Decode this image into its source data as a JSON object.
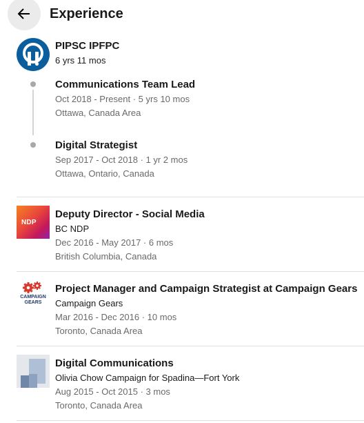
{
  "header": {
    "title": "Experience"
  },
  "experience": [
    {
      "company": "PIPSC IPFPC",
      "duration": "6 yrs 11 mos",
      "roles": [
        {
          "title": "Communications Team Lead",
          "dates": "Oct 2018 - Present · 5 yrs 10 mos",
          "location": "Ottawa, Canada Area"
        },
        {
          "title": "Digital Strategist",
          "dates": "Sep 2017 - Oct 2018 · 1 yr 2 mos",
          "location": "Ottawa, Ontario, Canada"
        }
      ]
    },
    {
      "title": "Deputy Director - Social Media",
      "company": "BC NDP",
      "dates": "Dec 2016 - May 2017 · 6 mos",
      "location": "British Columbia, Canada",
      "logo_text": "NDP"
    },
    {
      "title": "Project Manager and Campaign Strategist at Campaign Gears",
      "company": "Campaign Gears",
      "dates": "Mar 2016 - Dec 2016 · 10 mos",
      "location": "Toronto, Canada Area",
      "logo_line1": "CAMPAIGN",
      "logo_line2": "GEARS"
    },
    {
      "title": "Digital Communications",
      "company": "Olivia Chow Campaign for Spadina—Fort York",
      "dates": "Aug 2015 - Oct 2015 · 3 mos",
      "location": "Toronto, Canada Area"
    }
  ],
  "colors": {
    "pipsc_blue": "#0a5e9e",
    "ndp_orange": "#f58220",
    "gears_red": "#d9392b",
    "gears_navy": "#1f3a6b"
  },
  "icons": {
    "back": "arrow-left-icon"
  }
}
